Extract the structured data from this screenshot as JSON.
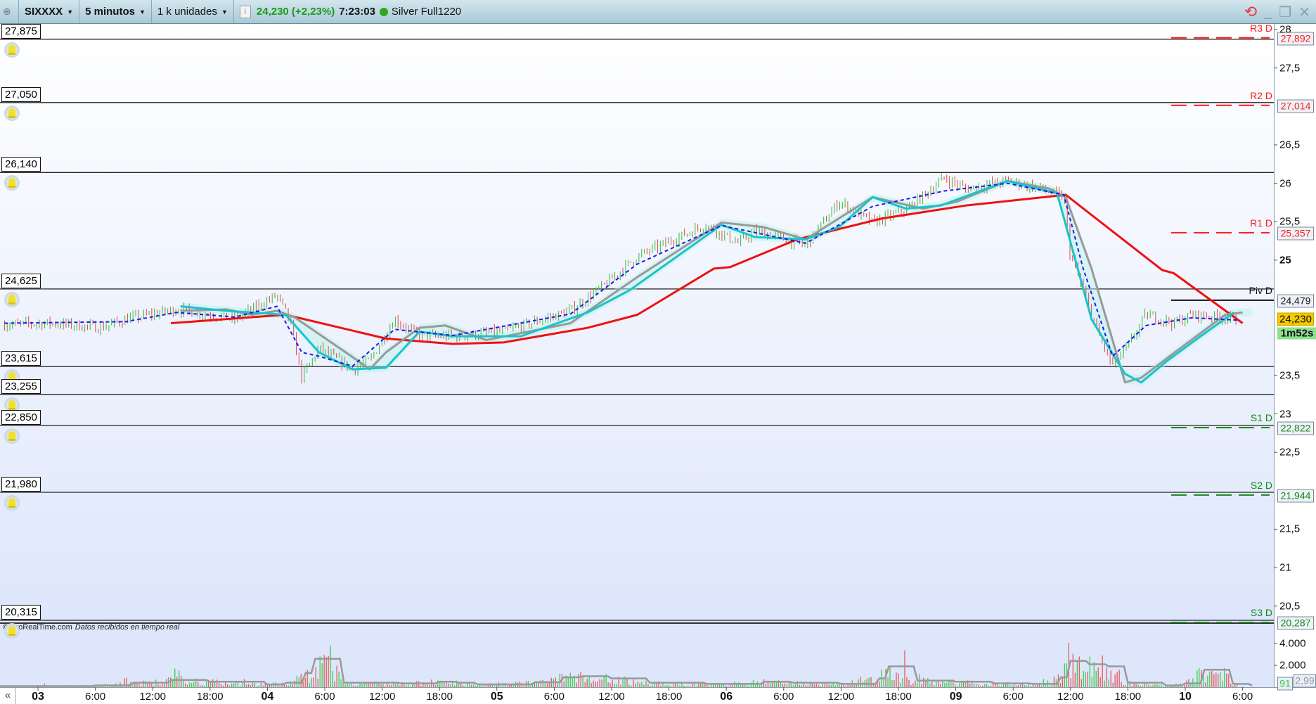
{
  "header": {
    "symbol": "SIXXXX",
    "timeframe": "5 minutos",
    "units": "1 k unidades",
    "price": "24,230 (+2,23%)",
    "time": "7:23:03",
    "instrument": "Silver Full1220",
    "price_color": "#1a9a1a"
  },
  "level_labels": [
    "27,875",
    "27,050",
    "26,140",
    "24,625",
    "23,615",
    "23,255",
    "22,850",
    "21,980",
    "20,315"
  ],
  "pivots": [
    {
      "name": "R3 D",
      "value": "27,892",
      "price": 27.892,
      "color": "#ff1a1a"
    },
    {
      "name": "R2 D",
      "value": "27,014",
      "price": 27.014,
      "color": "#ff1a1a"
    },
    {
      "name": "R1 D",
      "value": "25,357",
      "price": 25.357,
      "color": "#ff1a1a"
    },
    {
      "name": "Piv D",
      "value": "24,479",
      "price": 24.479,
      "color": "#111111"
    },
    {
      "name": "S1 D",
      "value": "22,822",
      "price": 22.822,
      "color": "#138a13"
    },
    {
      "name": "S2 D",
      "value": "21,944",
      "price": 21.944,
      "color": "#138a13"
    },
    {
      "name": "S3 D",
      "value": "20,287",
      "price": 20.287,
      "color": "#138a13"
    }
  ],
  "price_axis_ticks": [
    "28",
    "27,5",
    "26,5",
    "26",
    "25,5",
    "25",
    "23,5",
    "23",
    "22,5",
    "21,5",
    "21",
    "20,5"
  ],
  "current_price": "24,230",
  "countdown": "1m52s",
  "volume_axis_ticks": [
    "4.000",
    "2.000"
  ],
  "volume_current": "91",
  "volume_avg": "2,99",
  "credit": "© ProRealTime.com",
  "credit_note": "Datos recibidos en tiempo real",
  "scroll_back": "«",
  "x_axis_labels": [
    {
      "label": "03",
      "bold": true
    },
    {
      "label": "6:00"
    },
    {
      "label": "12:00"
    },
    {
      "label": "18:00"
    },
    {
      "label": "04",
      "bold": true
    },
    {
      "label": "6:00"
    },
    {
      "label": "12:00"
    },
    {
      "label": "18:00"
    },
    {
      "label": "05",
      "bold": true
    },
    {
      "label": "6:00"
    },
    {
      "label": "12:00"
    },
    {
      "label": "18:00"
    },
    {
      "label": "06",
      "bold": true
    },
    {
      "label": "6:00"
    },
    {
      "label": "12:00"
    },
    {
      "label": "18:00"
    },
    {
      "label": "09",
      "bold": true
    },
    {
      "label": "6:00"
    },
    {
      "label": "12:00"
    },
    {
      "label": "18:00"
    },
    {
      "label": "10",
      "bold": true
    },
    {
      "label": "6:00"
    }
  ],
  "chart_data": {
    "type": "line",
    "x_unit": "hours since day 03 00:00 (trading-day axis)",
    "ylim": [
      20.2,
      28.1
    ],
    "price_close": [
      [
        -3.5,
        24.16
      ],
      [
        1.3,
        24.18
      ],
      [
        6.6,
        24.12
      ],
      [
        9.2,
        24.23
      ],
      [
        14.5,
        24.36
      ],
      [
        20.6,
        24.23
      ],
      [
        25.0,
        24.54
      ],
      [
        26.3,
        24.23
      ],
      [
        27.6,
        23.47
      ],
      [
        29.4,
        23.85
      ],
      [
        32.9,
        23.58
      ],
      [
        34.7,
        23.69
      ],
      [
        37.3,
        24.23
      ],
      [
        39.9,
        24.01
      ],
      [
        43.4,
        24.01
      ],
      [
        48.7,
        24.07
      ],
      [
        55.7,
        24.34
      ],
      [
        59.2,
        24.67
      ],
      [
        62.7,
        25.05
      ],
      [
        69.8,
        25.46
      ],
      [
        73.3,
        25.22
      ],
      [
        75.0,
        25.38
      ],
      [
        80.3,
        25.19
      ],
      [
        83.8,
        25.76
      ],
      [
        87.3,
        25.49
      ],
      [
        90.8,
        25.65
      ],
      [
        94.8,
        26.07
      ],
      [
        97.0,
        25.93
      ],
      [
        101.4,
        26.03
      ],
      [
        104.9,
        25.93
      ],
      [
        107.3,
        25.82
      ],
      [
        107.9,
        25.11
      ],
      [
        109.3,
        24.61
      ],
      [
        111.0,
        24.01
      ],
      [
        112.4,
        23.63
      ],
      [
        114.1,
        23.9
      ],
      [
        115.9,
        24.29
      ],
      [
        118.9,
        24.18
      ],
      [
        120.7,
        24.29
      ],
      [
        124.2,
        24.26
      ],
      [
        125.5,
        24.2
      ]
    ],
    "series": [
      {
        "name": "MA red",
        "color": "#ee1111",
        "points": [
          [
            13.9,
            24.18
          ],
          [
            25.9,
            24.29
          ],
          [
            36.4,
            23.98
          ],
          [
            43.4,
            23.91
          ],
          [
            48.7,
            23.93
          ],
          [
            57.5,
            24.12
          ],
          [
            62.7,
            24.29
          ],
          [
            70.7,
            24.89
          ],
          [
            72.4,
            24.91
          ],
          [
            79.4,
            25.27
          ],
          [
            88.2,
            25.54
          ],
          [
            97.0,
            25.71
          ],
          [
            107.5,
            25.85
          ],
          [
            117.6,
            24.87
          ],
          [
            118.8,
            24.83
          ],
          [
            126.0,
            24.18
          ]
        ]
      },
      {
        "name": "MA gray",
        "color": "#999999",
        "points": [
          [
            14.9,
            24.34
          ],
          [
            19.7,
            24.36
          ],
          [
            22.4,
            24.29
          ],
          [
            25.0,
            24.34
          ],
          [
            26.8,
            24.26
          ],
          [
            32.9,
            23.74
          ],
          [
            34.7,
            23.58
          ],
          [
            36.4,
            23.8
          ],
          [
            39.9,
            24.12
          ],
          [
            42.6,
            24.15
          ],
          [
            46.9,
            23.96
          ],
          [
            55.7,
            24.18
          ],
          [
            62.7,
            24.78
          ],
          [
            71.5,
            25.49
          ],
          [
            75.9,
            25.43
          ],
          [
            80.3,
            25.27
          ],
          [
            87.3,
            25.82
          ],
          [
            92.6,
            25.67
          ],
          [
            96.1,
            25.76
          ],
          [
            101.4,
            26.03
          ],
          [
            105.8,
            25.93
          ],
          [
            107.5,
            25.82
          ],
          [
            110.2,
            24.89
          ],
          [
            113.7,
            23.41
          ],
          [
            115.4,
            23.47
          ],
          [
            118.9,
            23.8
          ],
          [
            124.2,
            24.29
          ],
          [
            126.0,
            24.32
          ]
        ]
      },
      {
        "name": "MA cyan",
        "color": "#19c3cc",
        "points": [
          [
            14.9,
            24.4
          ],
          [
            19.7,
            24.34
          ],
          [
            25.9,
            24.29
          ],
          [
            29.4,
            23.8
          ],
          [
            32.9,
            23.58
          ],
          [
            36.4,
            23.6
          ],
          [
            39.9,
            24.07
          ],
          [
            43.4,
            24.01
          ],
          [
            50.5,
            24.01
          ],
          [
            57.5,
            24.32
          ],
          [
            61.9,
            24.61
          ],
          [
            71.5,
            25.46
          ],
          [
            75.0,
            25.3
          ],
          [
            80.3,
            25.27
          ],
          [
            83.8,
            25.43
          ],
          [
            87.3,
            25.82
          ],
          [
            90.8,
            25.67
          ],
          [
            94.4,
            25.71
          ],
          [
            101.4,
            26.03
          ],
          [
            106.6,
            25.87
          ],
          [
            110.2,
            24.23
          ],
          [
            113.7,
            23.52
          ],
          [
            115.4,
            23.41
          ],
          [
            118.1,
            23.69
          ],
          [
            121.6,
            24.01
          ],
          [
            125.1,
            24.32
          ]
        ]
      },
      {
        "name": "MA blue dashed",
        "color": "#1a1aee",
        "points": [
          [
            -3.5,
            24.18
          ],
          [
            9.2,
            24.2
          ],
          [
            14.5,
            24.32
          ],
          [
            20.6,
            24.26
          ],
          [
            25.0,
            24.4
          ],
          [
            27.6,
            23.8
          ],
          [
            29.4,
            23.75
          ],
          [
            32.9,
            23.62
          ],
          [
            37.3,
            24.1
          ],
          [
            43.4,
            24.02
          ],
          [
            55.7,
            24.3
          ],
          [
            62.7,
            24.95
          ],
          [
            71.5,
            25.45
          ],
          [
            80.3,
            25.22
          ],
          [
            87.3,
            25.7
          ],
          [
            94.8,
            25.9
          ],
          [
            101.4,
            26.0
          ],
          [
            107.3,
            25.85
          ],
          [
            109.3,
            24.9
          ],
          [
            112.4,
            23.75
          ],
          [
            115.9,
            24.15
          ],
          [
            120.7,
            24.25
          ],
          [
            125.5,
            24.22
          ]
        ]
      }
    ],
    "volume": {
      "ylim": [
        0,
        5000
      ],
      "avg_line": [
        [
          -4,
          100
        ],
        [
          6,
          150
        ],
        [
          10,
          400
        ],
        [
          14,
          650
        ],
        [
          18,
          500
        ],
        [
          24,
          250
        ],
        [
          26,
          400
        ],
        [
          28,
          1300
        ],
        [
          29,
          2600
        ],
        [
          31,
          2600
        ],
        [
          32,
          400
        ],
        [
          38,
          350
        ],
        [
          42,
          500
        ],
        [
          44,
          400
        ],
        [
          46,
          250
        ],
        [
          52,
          450
        ],
        [
          55,
          900
        ],
        [
          57,
          1000
        ],
        [
          60,
          800
        ],
        [
          64,
          400
        ],
        [
          70,
          300
        ],
        [
          76,
          500
        ],
        [
          79,
          400
        ],
        [
          84,
          300
        ],
        [
          88,
          800
        ],
        [
          89,
          1900
        ],
        [
          92,
          600
        ],
        [
          96,
          500
        ],
        [
          100,
          350
        ],
        [
          104,
          300
        ],
        [
          107,
          900
        ],
        [
          108,
          2400
        ],
        [
          110,
          2100
        ],
        [
          112,
          1900
        ],
        [
          114,
          400
        ],
        [
          118,
          150
        ],
        [
          120,
          350
        ],
        [
          122,
          1600
        ],
        [
          124,
          1600
        ],
        [
          125,
          300
        ],
        [
          127,
          150
        ]
      ]
    }
  }
}
